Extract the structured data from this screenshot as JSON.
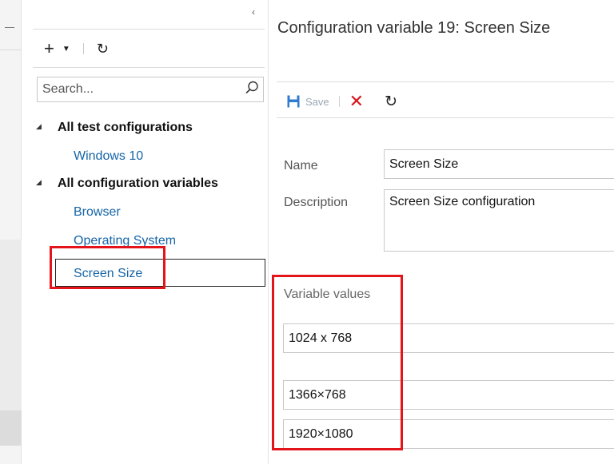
{
  "tree_panel": {
    "collapse_glyph": "‹",
    "toolbar": {
      "add_icon": "plus-icon",
      "dropdown_icon": "caret-down-icon",
      "refresh_icon": "refresh-icon"
    },
    "search": {
      "placeholder": "Search...",
      "value": ""
    },
    "groups": [
      {
        "label": "All test configurations",
        "items": [
          {
            "label": "Windows 10",
            "selected": false
          }
        ]
      },
      {
        "label": "All configuration variables",
        "items": [
          {
            "label": "Browser",
            "selected": false
          },
          {
            "label": "Operating System",
            "selected": false
          },
          {
            "label": "Screen Size",
            "selected": true
          }
        ]
      }
    ]
  },
  "detail": {
    "title": "Configuration variable 19: Screen Size",
    "toolbar": {
      "save_label": "Save",
      "save_icon": "save-icon",
      "discard_icon": "close-icon",
      "refresh_icon": "refresh-icon"
    },
    "form": {
      "name_label": "Name",
      "name_value": "Screen Size",
      "description_label": "Description",
      "description_value": "Screen Size configuration",
      "variable_values_label": "Variable values",
      "values": [
        "1024 x 768",
        "1366×768",
        "1920×1080"
      ]
    }
  },
  "colors": {
    "highlight_red": "#e3151a",
    "link_blue": "#1565a8",
    "save_disabled": "#9aa7b4"
  }
}
